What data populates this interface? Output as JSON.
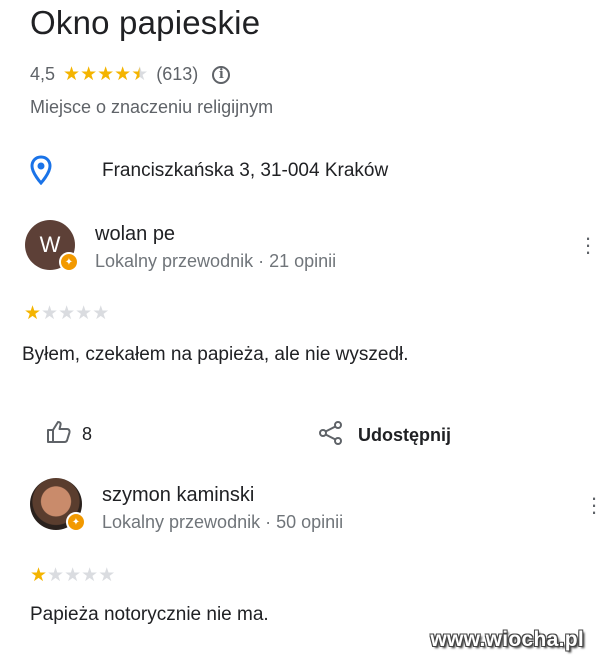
{
  "place": {
    "title": "Okno papieskie",
    "rating": "4,5",
    "stars": 4.5,
    "review_count": "(613)",
    "category": "Miejsce o znaczeniu religijnym",
    "address": "Franciszkańska 3, 31-004 Kraków"
  },
  "reviews": [
    {
      "author": "wolan pe",
      "avatar_letter": "W",
      "subtitle": "Lokalny przewodnik · 21 opinii",
      "stars": 1,
      "text": "Byłem, czekałem na papieża, ale nie wyszedł.",
      "likes": "8",
      "share_label": "Udostępnij"
    },
    {
      "author": "szymon kaminski",
      "subtitle": "Lokalny przewodnik · 50 opinii",
      "stars": 1,
      "text": "Papieża notorycznie nie ma."
    }
  ],
  "watermark": "www.wiocha.pl",
  "colors": {
    "star_filled": "#f4b400",
    "star_empty": "#dadce0",
    "pin": "#1a73e8",
    "badge": "#f29900",
    "avatar_w": "#5d4037"
  },
  "icons": [
    "info-icon",
    "location-pin-icon",
    "more-vert-icon",
    "thumbs-up-icon",
    "share-icon",
    "local-guide-badge-icon"
  ]
}
